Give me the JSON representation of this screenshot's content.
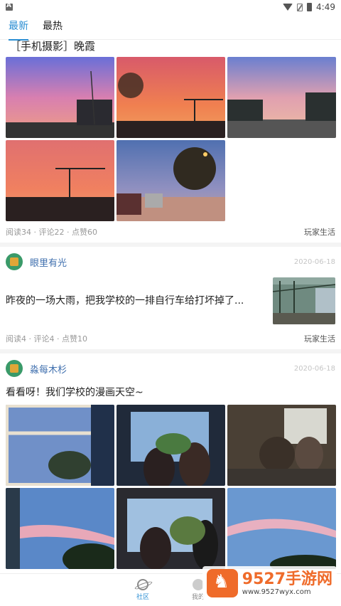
{
  "status_bar": {
    "time": "4:49"
  },
  "tabs": [
    {
      "label": "最新",
      "active": true
    },
    {
      "label": "最热",
      "active": false
    }
  ],
  "post1": {
    "title": "［手机摄影］晚霞",
    "stats": "阅读34 · 评论22 · 点赞60",
    "category": "玩家生活"
  },
  "post2": {
    "user": "眼里有光",
    "date": "2020-06-18",
    "text": "昨夜的一场大雨，把我学校的一排自行车给打坏掉了...",
    "stats": "阅读4 · 评论4 · 点赞10",
    "category": "玩家生活"
  },
  "post3": {
    "user": "淼每木杉",
    "date": "2020-06-18",
    "text": "看看呀！我们学校的漫画天空~"
  },
  "bottom_nav": [
    {
      "label": "社区",
      "icon": "planet-icon",
      "active": true
    },
    {
      "label": "我的",
      "icon": "profile-icon",
      "active": false
    }
  ],
  "watermark": {
    "brand": "9527手游网",
    "url": "www.9527wyx.com"
  },
  "colors": {
    "accent": "#2a8ed3",
    "username": "#3f6fae",
    "watermark": "#ef6b2a"
  }
}
